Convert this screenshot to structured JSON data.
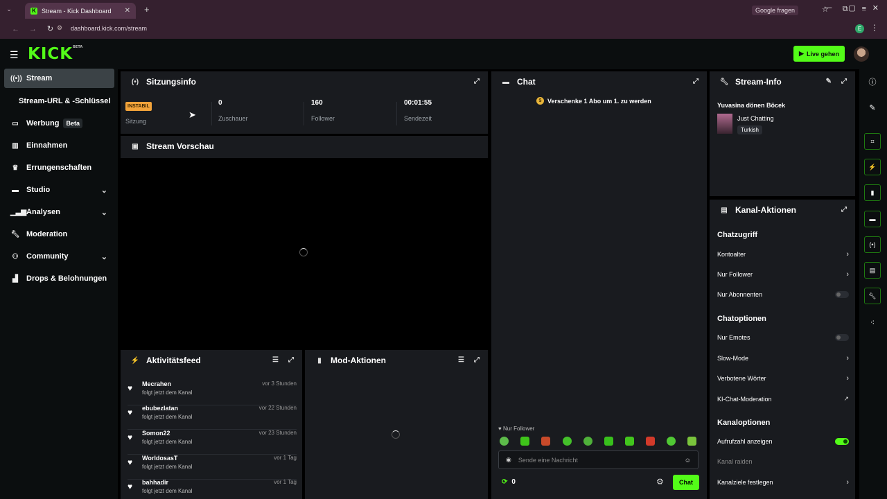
{
  "browser": {
    "tab_title": "Stream - Kick Dashboard",
    "url": "dashboard.kick.com/stream",
    "google_ask": "Google fragen",
    "profile_letter": "E"
  },
  "header": {
    "logo": "KICK",
    "logo_sup": "BETA",
    "live_button": "Live gehen"
  },
  "sidebar": {
    "items": [
      {
        "label": "Stream",
        "icon": "broadcast-icon"
      },
      {
        "label": "Stream-URL & -Schlüssel"
      },
      {
        "label": "Werbung",
        "badge": "Beta",
        "icon": "ad-icon"
      },
      {
        "label": "Einnahmen",
        "icon": "chart-icon"
      },
      {
        "label": "Errungenschaften",
        "icon": "trophy-icon"
      },
      {
        "label": "Studio",
        "icon": "studio-icon"
      },
      {
        "label": "Analysen",
        "icon": "analytics-icon"
      },
      {
        "label": "Moderation",
        "icon": "wrench-icon"
      },
      {
        "label": "Community",
        "icon": "community-icon"
      },
      {
        "label": "Drops & Belohnungen",
        "icon": "drops-icon"
      }
    ]
  },
  "session": {
    "title": "Sitzungsinfo",
    "status_badge": "INSTABIL",
    "status_label": "Sitzung",
    "viewers": "0",
    "viewers_label": "Zuschauer",
    "followers": "160",
    "followers_label": "Follower",
    "time": "00:01:55",
    "time_label": "Sendezeit"
  },
  "preview": {
    "title": "Stream Vorschau"
  },
  "activity": {
    "title": "Aktivitätsfeed",
    "items": [
      {
        "name": "Mecrahen",
        "desc": "folgt jetzt dem Kanal",
        "time": "vor 3 Stunden"
      },
      {
        "name": "ebubezlatan",
        "desc": "folgt jetzt dem Kanal",
        "time": "vor 22 Stunden"
      },
      {
        "name": "Somon22",
        "desc": "folgt jetzt dem Kanal",
        "time": "vor 23 Stunden"
      },
      {
        "name": "WorldosasT",
        "desc": "folgt jetzt dem Kanal",
        "time": "vor 1 Tag"
      },
      {
        "name": "bahhadir",
        "desc": "folgt jetzt dem Kanal",
        "time": "vor 1 Tag"
      }
    ]
  },
  "mod": {
    "title": "Mod-Aktionen"
  },
  "chat": {
    "title": "Chat",
    "banner": "Verschenke 1 Abo um 1. zu werden",
    "mode": "Nur Follower",
    "placeholder": "Sende eine Nachricht",
    "points": "0",
    "send": "Chat"
  },
  "stream_info": {
    "title": "Stream-Info",
    "stream_title": "Yuvasina dönen Böcek",
    "category": "Just Chatting",
    "language": "Turkish"
  },
  "channel_actions": {
    "title": "Kanal-Aktionen",
    "chat_access": "Chatzugriff",
    "account_age": "Kontoalter",
    "followers_only": "Nur Follower",
    "subscribers_only": "Nur Abonnenten",
    "chat_options": "Chatoptionen",
    "emotes_only": "Nur Emotes",
    "slow_mode": "Slow-Mode",
    "banned_words": "Verbotene Wörter",
    "ai_moderation": "KI-Chat-Moderation",
    "channel_options": "Kanaloptionen",
    "show_viewers": "Aufrufzahl anzeigen",
    "raid": "Kanal raiden",
    "goals": "Kanalziele festlegen"
  },
  "colors": {
    "accent": "#53fc18",
    "panel": "#191b1f",
    "warning": "#f2a33a"
  }
}
